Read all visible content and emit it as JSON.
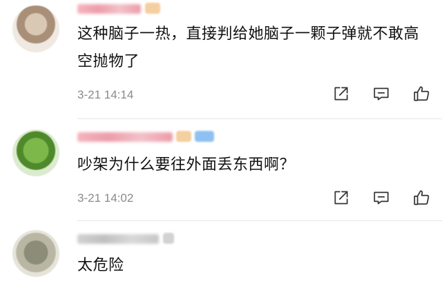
{
  "comments": [
    {
      "text": "这种脑子一热，直接判给她脑子一颗子弹就不敢高空抛物了",
      "time": "3-21 14:14"
    },
    {
      "text": "吵架为什么要往外面丢东西啊？",
      "time": "3-21 14:02"
    },
    {
      "text": "太危险",
      "time": ""
    }
  ],
  "icons": {
    "share": "share-icon",
    "reply": "comment-icon",
    "like": "thumbs-up-icon"
  },
  "colors": {
    "username_pink": "#e98d9c",
    "timestamp": "#8a8a8a",
    "divider": "#e6e6e6"
  }
}
